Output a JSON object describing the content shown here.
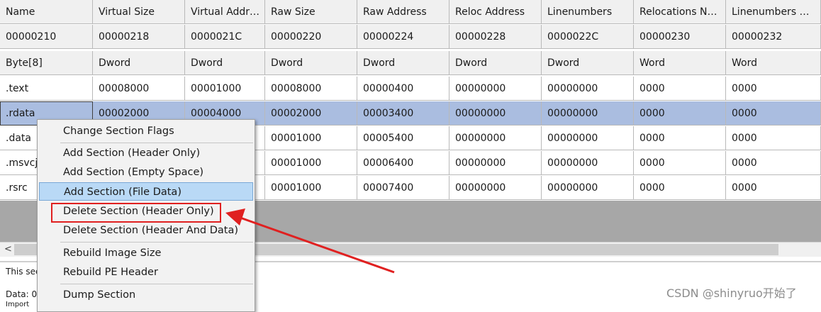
{
  "table": {
    "columns": [
      "Name",
      "Virtual Size",
      "Virtual Addr…",
      "Raw Size",
      "Raw Address",
      "Reloc Address",
      "Linenumbers",
      "Relocations N…",
      "Linenumbers …"
    ],
    "offsets": [
      "00000210",
      "00000218",
      "0000021C",
      "00000220",
      "00000224",
      "00000228",
      "0000022C",
      "00000230",
      "00000232"
    ],
    "types": [
      "Byte[8]",
      "Dword",
      "Dword",
      "Dword",
      "Dword",
      "Dword",
      "Dword",
      "Word",
      "Word"
    ],
    "rows": [
      [
        ".text",
        "00008000",
        "00001000",
        "00008000",
        "00000400",
        "00000000",
        "00000000",
        "0000",
        "0000"
      ],
      [
        ".rdata",
        "00002000",
        "00004000",
        "00002000",
        "00003400",
        "00000000",
        "00000000",
        "0000",
        "0000"
      ],
      [
        ".data",
        "",
        "",
        "00001000",
        "00005400",
        "00000000",
        "00000000",
        "0000",
        "0000"
      ],
      [
        ".msvcj",
        "",
        "",
        "00001000",
        "00006400",
        "00000000",
        "00000000",
        "0000",
        "0000"
      ],
      [
        ".rsrc",
        "",
        "",
        "00001000",
        "00007400",
        "00000000",
        "00000000",
        "0000",
        "0000"
      ]
    ]
  },
  "scrollbar": {
    "left_arrow": "<"
  },
  "bottom_pane": {
    "line1": "This sec",
    "line2": "Data: 0",
    "line3": "Import"
  },
  "context_menu": {
    "change_flags": "Change Section Flags",
    "add_header_only": "Add Section (Header Only)",
    "add_empty_space": "Add Section (Empty Space)",
    "add_file_data": "Add Section (File Data)",
    "delete_header_only": "Delete Section (Header Only)",
    "delete_header_and_data": "Delete Section (Header And Data)",
    "rebuild_image_size": "Rebuild Image Size",
    "rebuild_pe_header": "Rebuild PE Header",
    "dump_section": "Dump Section"
  },
  "annotation": {
    "color": "#e02020"
  },
  "watermark": "CSDN @shinyruo开始了"
}
